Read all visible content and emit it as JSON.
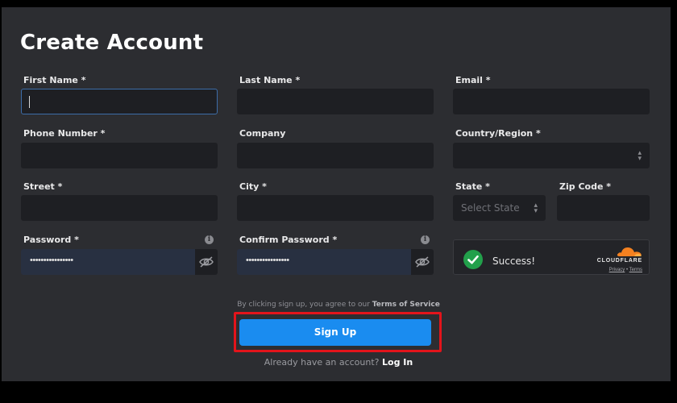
{
  "title": "Create Account",
  "fields": {
    "first_name": {
      "label": "First Name *",
      "value": ""
    },
    "last_name": {
      "label": "Last Name *",
      "value": ""
    },
    "email": {
      "label": "Email *",
      "value": ""
    },
    "phone": {
      "label": "Phone Number *",
      "value": ""
    },
    "company": {
      "label": "Company",
      "value": ""
    },
    "country": {
      "label": "Country/Region *",
      "value": ""
    },
    "street": {
      "label": "Street *",
      "value": ""
    },
    "city": {
      "label": "City *",
      "value": ""
    },
    "state": {
      "label": "State *",
      "placeholder": "Select State"
    },
    "zip": {
      "label": "Zip Code *",
      "value": ""
    },
    "password": {
      "label": "Password *",
      "masked": "••••••••••••••••"
    },
    "confirm_password": {
      "label": "Confirm Password *",
      "masked": "••••••••••••••••"
    }
  },
  "captcha": {
    "status": "Success!",
    "brand": "CLOUDFLARE",
    "privacy": "Privacy",
    "separator": "•",
    "terms": "Terms"
  },
  "footer": {
    "agree_text": "By clicking sign up, you agree to our",
    "terms_link": "Terms of Service",
    "signup_label": "Sign Up",
    "have_account": "Already have an account?",
    "login_link": "Log In"
  },
  "colors": {
    "background": "#2c2d31",
    "field": "#1e1f23",
    "primary": "#1a8cf0",
    "highlight": "#e3141b",
    "success": "#22a04b",
    "cloudflare_orange": "#f48120"
  },
  "icons": [
    "eye-slash-icon",
    "info-icon",
    "check-circle-icon",
    "cloudflare-logo-icon",
    "chevron-updown-icon"
  ]
}
